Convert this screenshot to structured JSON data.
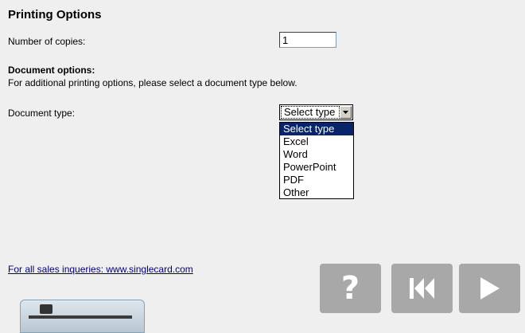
{
  "page": {
    "title": "Printing Options",
    "copies_label": "Number of copies:",
    "copies_value": "1",
    "document_options_heading": "Document options:",
    "document_options_help": "For additional printing options, please select a document type below.",
    "document_type_label": "Document type:",
    "document_type_selected": "Select type",
    "document_type_options": [
      "Select type",
      "Excel",
      "Word",
      "PowerPoint",
      "PDF",
      "Other"
    ],
    "sales_link": "For all sales inqueries: www.singlecard.com"
  },
  "buttons": {
    "help_glyph": "?",
    "help_icon": "question-mark-icon",
    "back_icon": "skip-to-start-icon",
    "next_icon": "play-forward-icon"
  },
  "colors": {
    "background": "#efefef",
    "button": "#a8a8a8",
    "selection": "#0a246a",
    "link": "#000080"
  }
}
